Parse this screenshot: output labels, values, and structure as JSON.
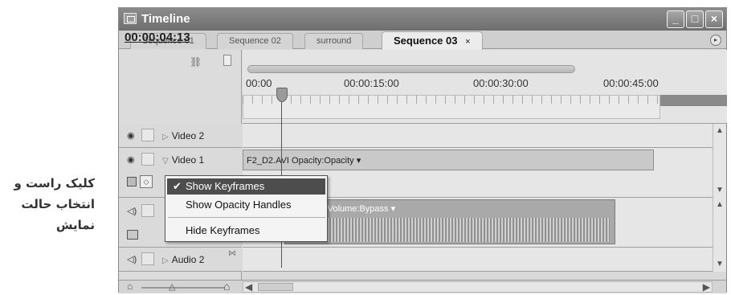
{
  "annotation": {
    "lines": [
      "کلیک راست و",
      "انتخاب حالت",
      "نمایش"
    ]
  },
  "window": {
    "title": "Timeline",
    "buttons": {
      "minimize": "_",
      "maximize": "□",
      "close": "×"
    }
  },
  "tabs": [
    {
      "label": "Sequence 01"
    },
    {
      "label": "Sequence 02"
    },
    {
      "label": "surround"
    },
    {
      "label": "Sequence 03",
      "close": "×",
      "active": true
    }
  ],
  "panel_menu_glyph": "▸",
  "timecode": "00:00:04:13",
  "ruler": {
    "labels": [
      "00:00",
      "00:00:15:00",
      "00:00:30:00",
      "00:00:45:00"
    ]
  },
  "tracks": {
    "video2": {
      "name": "Video 2",
      "expand": "▷",
      "eye": "◉"
    },
    "video1": {
      "name": "Video 1",
      "expand": "▽",
      "eye": "◉",
      "clip": "F2_D2.AVI Opacity:Opacity ▾"
    },
    "audio1": {
      "clip": "r Volume:Bypass ▾",
      "speaker": "◁)"
    },
    "audio2": {
      "name": "Audio 2",
      "expand": "▷",
      "speaker": "◁)"
    }
  },
  "context_menu": {
    "items": [
      {
        "label": "Show Keyframes",
        "checked": true
      },
      {
        "label": "Show Opacity Handles"
      },
      {
        "label": "Hide Keyframes"
      }
    ],
    "check_glyph": "✔"
  },
  "scroll": {
    "up": "▲",
    "down": "▼",
    "left": "◀",
    "right": "▶"
  },
  "zoom": {
    "out": "⌂",
    "thumb": "△",
    "in": "⌂"
  },
  "colors": {
    "highlight": "#4d4d4d",
    "titlebar": "#7a7a7a"
  }
}
